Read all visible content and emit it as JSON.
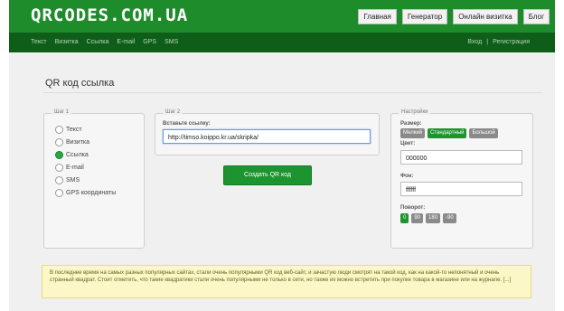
{
  "header": {
    "logo": "QRCODES.COM.UA",
    "nav": [
      "Главная",
      "Генератор",
      "Онлайн визитка",
      "Блог"
    ]
  },
  "subnav": {
    "items": [
      "Текст",
      "Визитка",
      "Ссылка",
      "E-mail",
      "GPS",
      "SMS"
    ],
    "login": "Вход",
    "separator": "|",
    "register": "Регистрация"
  },
  "page_title": "QR код ссылка",
  "step1": {
    "legend": "Шаг 1",
    "options": [
      "Текст",
      "Визитка",
      "Ссылка",
      "E-mail",
      "SMS",
      "GPS координаты"
    ],
    "selected": "Ссылка"
  },
  "step2": {
    "legend": "Шаг 2",
    "label": "Вставьте ссылку:",
    "value": "http://timso.koippo.kr.ua/skripka/"
  },
  "create_button": "Создать QR код",
  "settings": {
    "legend": "Настройки",
    "size_label": "Размер:",
    "sizes": [
      "Мелкий",
      "Стандартный",
      "Большой"
    ],
    "size_selected": "Стандартный",
    "color_label": "Цвет:",
    "color_value": "000000",
    "bg_label": "Фон:",
    "bg_value": "ffffff",
    "rotate_label": "Поворот:",
    "rotations": [
      "0",
      "90",
      "180",
      "-90"
    ],
    "rotation_selected": "0"
  },
  "notice": "В последнее время на самых разных популярных сайтах, стали очень популярными QR код веб-сайт, и зачастую люди смотрят на такой код, как на какой-то непонятный и очень странный квадрат. Стоит отметить, что такие квадратики стали очень популярными не только в сети, но также их можно встретить при покупке товара в магазине или на журнале. [...]",
  "colors": {
    "header_green": "#1f8c2c",
    "subnav_green": "#0e5d19",
    "accent": "#1e9430",
    "notice_bg": "#fbf7c6"
  }
}
